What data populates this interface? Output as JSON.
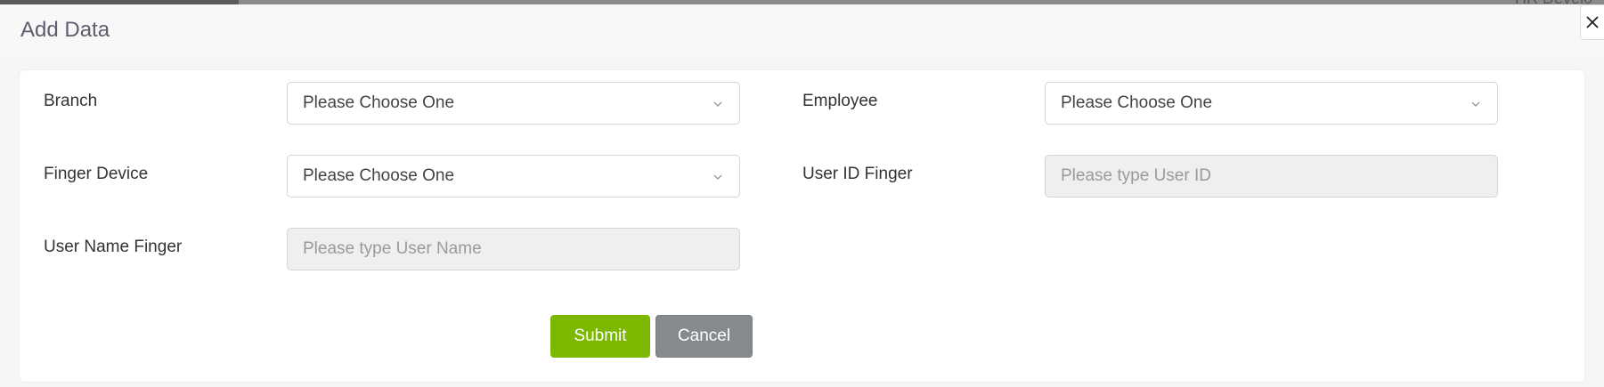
{
  "modal": {
    "title": "Add Data"
  },
  "backdrop": {
    "partial_text": "HR Develo"
  },
  "form": {
    "branch": {
      "label": "Branch",
      "value": "Please Choose One"
    },
    "employee": {
      "label": "Employee",
      "value": "Please Choose One"
    },
    "finger_device": {
      "label": "Finger Device",
      "value": "Please Choose One"
    },
    "user_id_finger": {
      "label": "User ID Finger",
      "placeholder": "Please type User ID"
    },
    "user_name_finger": {
      "label": "User Name Finger",
      "placeholder": "Please type User Name"
    }
  },
  "actions": {
    "submit_label": "Submit",
    "cancel_label": "Cancel"
  },
  "colors": {
    "submit": "#7cb800",
    "cancel": "#868a8f",
    "title": "#5d5d6e"
  }
}
